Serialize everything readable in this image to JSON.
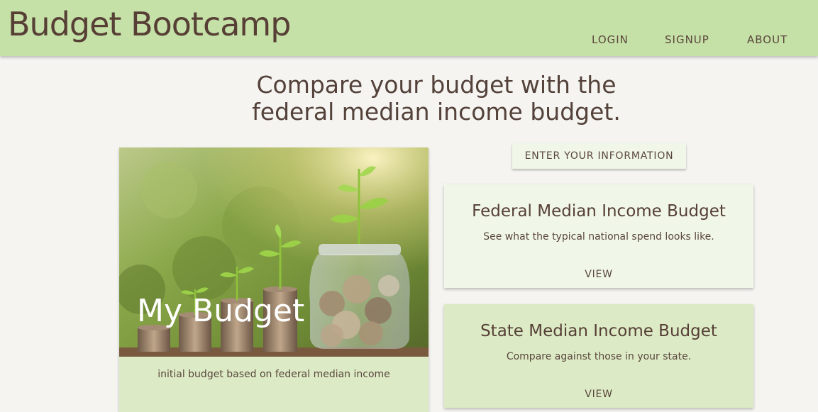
{
  "header": {
    "brand": "Budget Bootcamp",
    "nav": [
      "LOGIN",
      "SIGNUP",
      "ABOUT"
    ]
  },
  "headline": {
    "line1": "Compare your budget with the",
    "line2": "federal median income budget."
  },
  "my_budget_card": {
    "title": "My Budget",
    "caption": "initial budget based on federal median income"
  },
  "enter_button": "ENTER YOUR INFORMATION",
  "federal_card": {
    "title": "Federal Median Income Budget",
    "description": "See what the typical national spend looks like.",
    "link": "VIEW"
  },
  "state_card": {
    "title": "State Median Income Budget",
    "description": "Compare against those in your state.",
    "link": "VIEW"
  },
  "colors": {
    "navbar": "#c5e1a7",
    "background": "#f5f4f1",
    "text": "#53413a",
    "card_light": "#f1f7e8",
    "card_green": "#dcebc6"
  }
}
